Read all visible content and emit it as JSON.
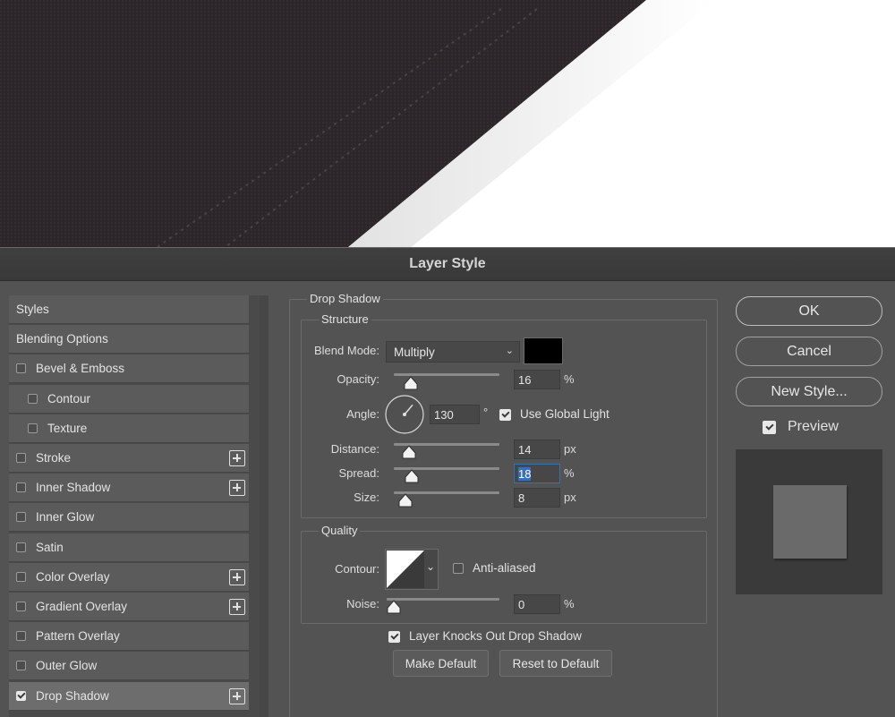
{
  "dialog": {
    "title": "Layer Style"
  },
  "styles_list": [
    {
      "label": "Styles",
      "checkbox": false,
      "plus": false,
      "indent": 0,
      "selected": false
    },
    {
      "label": "Blending Options",
      "checkbox": false,
      "plus": false,
      "indent": 0,
      "selected": false
    },
    {
      "label": "Bevel & Emboss",
      "checkbox": true,
      "checked": false,
      "plus": false,
      "indent": 0,
      "selected": false
    },
    {
      "label": "Contour",
      "checkbox": true,
      "checked": false,
      "plus": false,
      "indent": 1,
      "selected": false
    },
    {
      "label": "Texture",
      "checkbox": true,
      "checked": false,
      "plus": false,
      "indent": 1,
      "selected": false
    },
    {
      "label": "Stroke",
      "checkbox": true,
      "checked": false,
      "plus": true,
      "indent": 0,
      "selected": false
    },
    {
      "label": "Inner Shadow",
      "checkbox": true,
      "checked": false,
      "plus": true,
      "indent": 0,
      "selected": false
    },
    {
      "label": "Inner Glow",
      "checkbox": true,
      "checked": false,
      "plus": false,
      "indent": 0,
      "selected": false
    },
    {
      "label": "Satin",
      "checkbox": true,
      "checked": false,
      "plus": false,
      "indent": 0,
      "selected": false
    },
    {
      "label": "Color Overlay",
      "checkbox": true,
      "checked": false,
      "plus": true,
      "indent": 0,
      "selected": false
    },
    {
      "label": "Gradient Overlay",
      "checkbox": true,
      "checked": false,
      "plus": true,
      "indent": 0,
      "selected": false
    },
    {
      "label": "Pattern Overlay",
      "checkbox": true,
      "checked": false,
      "plus": false,
      "indent": 0,
      "selected": false
    },
    {
      "label": "Outer Glow",
      "checkbox": true,
      "checked": false,
      "plus": false,
      "indent": 0,
      "selected": false
    },
    {
      "label": "Drop Shadow",
      "checkbox": true,
      "checked": true,
      "plus": true,
      "indent": 0,
      "selected": true
    }
  ],
  "drop_shadow": {
    "title": "Drop Shadow",
    "structure": {
      "title": "Structure",
      "blend_mode_label": "Blend Mode:",
      "blend_mode_value": "Multiply",
      "color": "#000000",
      "opacity_label": "Opacity:",
      "opacity_value": "16",
      "opacity_unit": "%",
      "angle_label": "Angle:",
      "angle_value": "130",
      "angle_unit": "°",
      "global_light_label": "Use Global Light",
      "global_light_checked": true,
      "distance_label": "Distance:",
      "distance_value": "14",
      "distance_unit": "px",
      "spread_label": "Spread:",
      "spread_value": "18",
      "spread_unit": "%",
      "size_label": "Size:",
      "size_value": "8",
      "size_unit": "px"
    },
    "quality": {
      "title": "Quality",
      "contour_label": "Contour:",
      "anti_aliased_label": "Anti-aliased",
      "anti_aliased_checked": false,
      "noise_label": "Noise:",
      "noise_value": "0",
      "noise_unit": "%"
    },
    "knockout_label": "Layer Knocks Out Drop Shadow",
    "knockout_checked": true,
    "make_default_label": "Make Default",
    "reset_default_label": "Reset to Default"
  },
  "buttons": {
    "ok": "OK",
    "cancel": "Cancel",
    "new_style": "New Style...",
    "preview_label": "Preview",
    "preview_checked": true
  },
  "slider_levels": {
    "opacity": 0.16,
    "distance": 0.14,
    "spread": 0.18,
    "size": 0.08,
    "noise": 0.0
  },
  "colors": {
    "dialog_bg": "#535353",
    "title_bg": "#3d3d3d",
    "selection": "#3a6fb0"
  }
}
